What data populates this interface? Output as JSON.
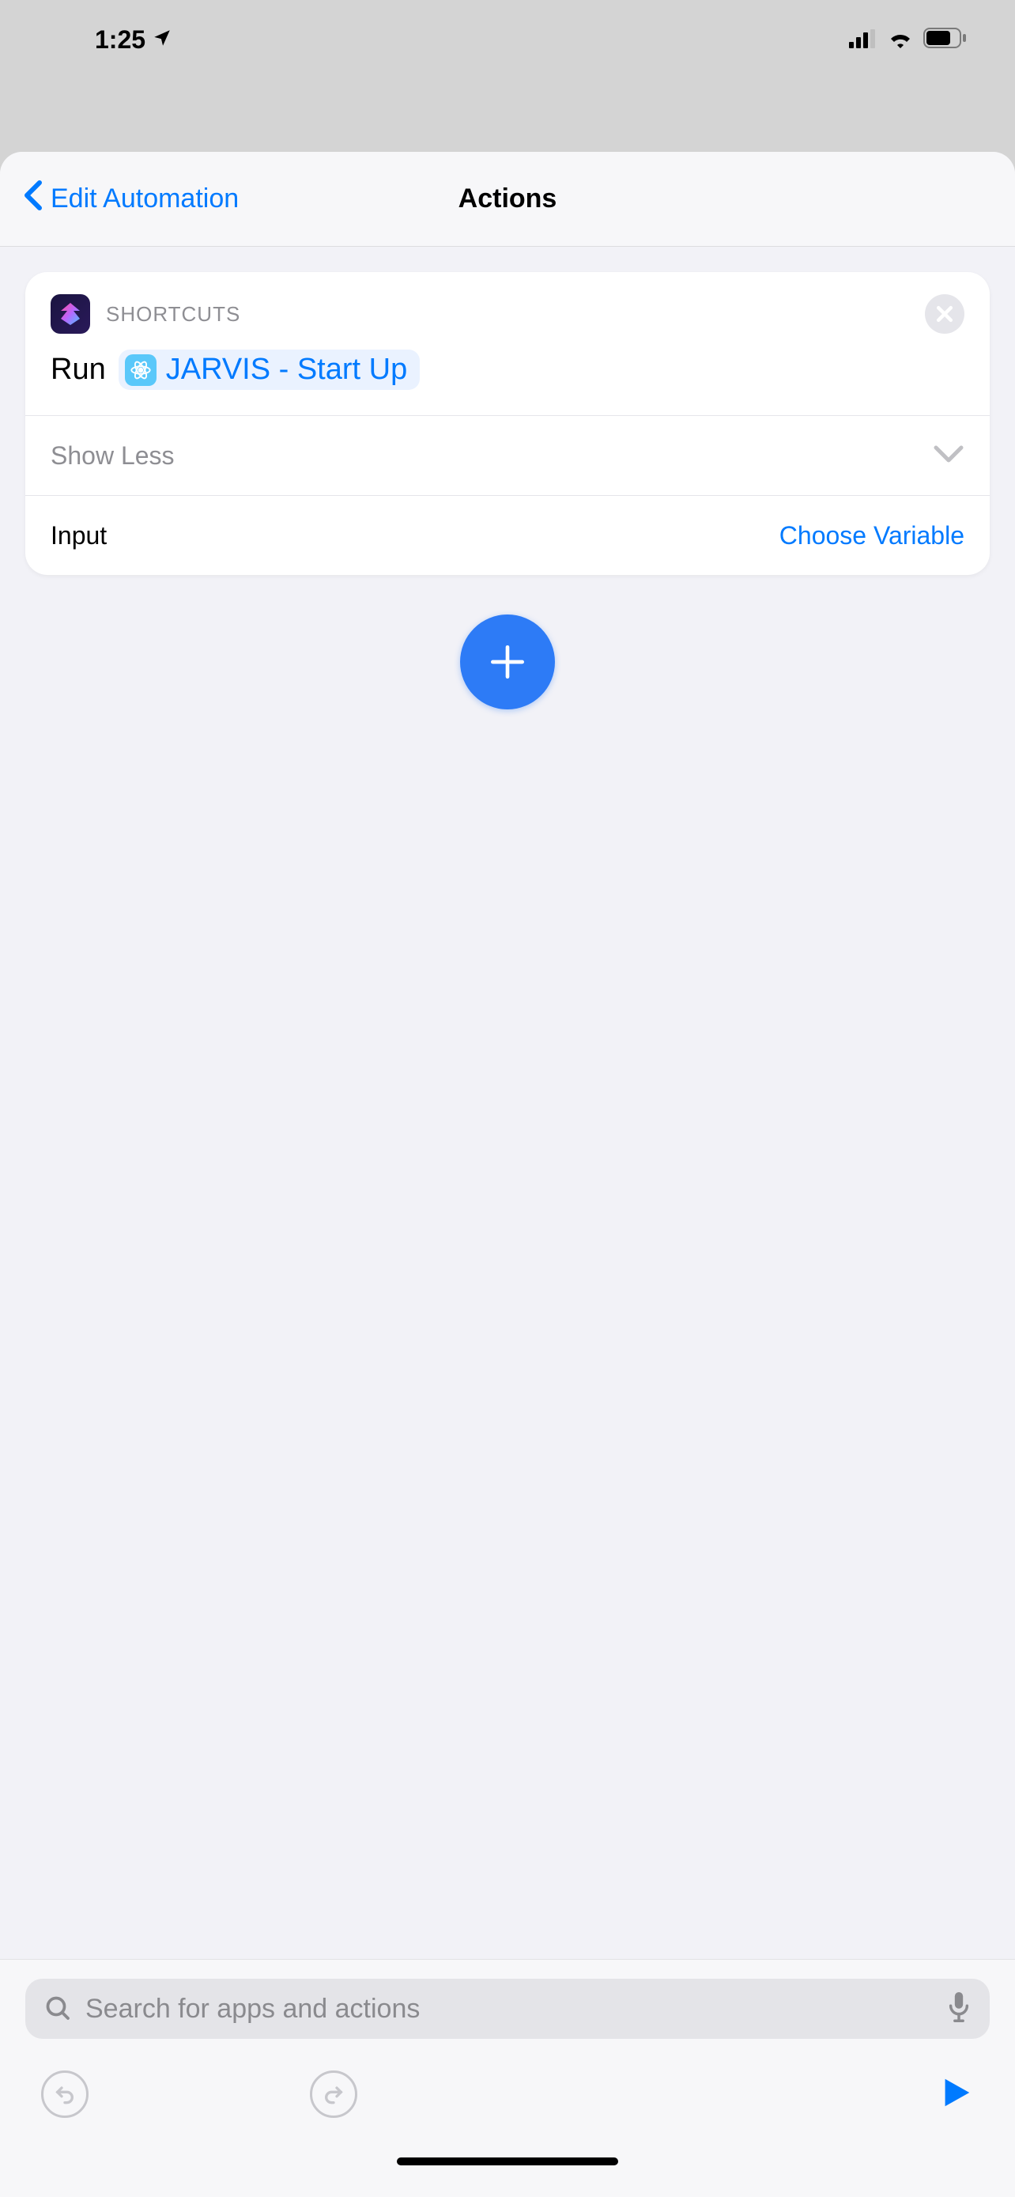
{
  "statusbar": {
    "time": "1:25"
  },
  "nav": {
    "back_label": "Edit Automation",
    "title": "Actions"
  },
  "card": {
    "app_name": "SHORTCUTS",
    "run_label": "Run",
    "shortcut_name": "JARVIS - Start Up",
    "show_less": "Show Less",
    "input_label": "Input",
    "input_value": "Choose Variable"
  },
  "search": {
    "placeholder": "Search for apps and actions"
  }
}
